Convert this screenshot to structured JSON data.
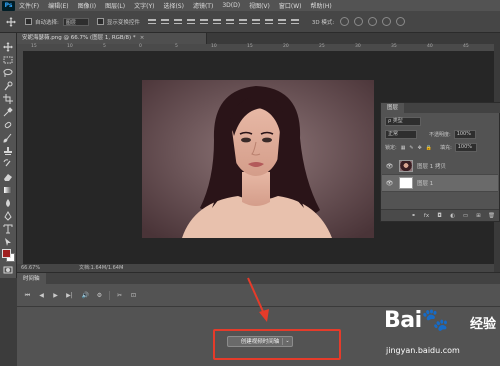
{
  "menu": {
    "app_logo": "Ps",
    "items": [
      "文件(F)",
      "编辑(E)",
      "图像(I)",
      "图层(L)",
      "文字(Y)",
      "选择(S)",
      "滤镜(T)",
      "3D(D)",
      "视图(V)",
      "窗口(W)",
      "帮助(H)"
    ]
  },
  "options_bar": {
    "auto_select_label": "自动选择:",
    "auto_select_value": "图层",
    "show_transform_label": "显示变换控件",
    "mode_3d_label": "3D 模式:"
  },
  "document": {
    "tab_title": "安妮海瑟薇.png @ 66.7% (图层 1, RGB/8) *",
    "close_glyph": "×",
    "ruler_numbers": [
      "15",
      "10",
      "5",
      "0",
      "5",
      "10",
      "15",
      "20",
      "25",
      "30",
      "35",
      "40",
      "45"
    ],
    "zoom": "66.67%",
    "doc_size": "文档:1.64M/1.64M",
    "status_arrow": "›"
  },
  "layers_panel": {
    "tab": "图层",
    "filter_label": "ρ 类型",
    "blend_mode": "正常",
    "opacity_label": "不透明度:",
    "opacity_value": "100%",
    "lock_label": "锁定:",
    "fill_label": "填充:",
    "fill_value": "100%",
    "layers": [
      {
        "name": "图层 1 拷贝",
        "visible_glyph": "👁",
        "thumb": "photo",
        "selected": false
      },
      {
        "name": "图层 1",
        "visible_glyph": "👁",
        "thumb": "white",
        "selected": true
      }
    ],
    "footer_icons": [
      "link-icon",
      "fx-icon",
      "mask-icon",
      "adjustment-icon",
      "group-icon",
      "new-layer-icon",
      "trash-icon"
    ],
    "footer_glyphs": [
      "⚭",
      "fx",
      "◘",
      "◐",
      "▭",
      "⊞",
      "🗑"
    ]
  },
  "timeline": {
    "tab": "时间轴",
    "controls": [
      "⏮",
      "◀",
      "▶",
      "▶|",
      "🔊",
      "⚙",
      "✂",
      "⊡"
    ],
    "create_button_label": "创建视频时间轴",
    "dropdown_glyph": "⌄"
  },
  "colors": {
    "foreground": "#a02020",
    "background": "#ffffff",
    "highlight": "#e53b2a"
  },
  "watermark": {
    "brand": "Bai",
    "brand_suffix": "百",
    "cn": "经验",
    "url": "jingyan.baidu.com"
  }
}
